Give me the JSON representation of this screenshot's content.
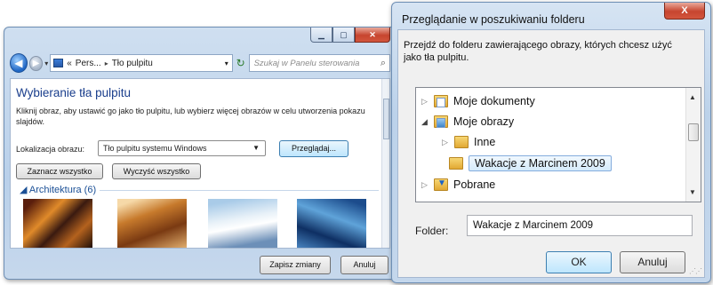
{
  "control_panel": {
    "address": {
      "crumbs": [
        "«",
        "Pers...",
        "Tło pulpitu"
      ],
      "separator": "▸"
    },
    "search_placeholder": "Szukaj w Panelu sterowania",
    "title": "Wybieranie tła pulpitu",
    "description": "Kliknij obraz, aby ustawić go jako tło pulpitu, lub wybierz więcej obrazów w celu utworzenia pokazu slajdów.",
    "location_label": "Lokalizacja obrazu:",
    "location_value": "Tło pulpitu systemu Windows",
    "browse_button": "Przeglądaj...",
    "select_all_button": "Zaznacz wszystko",
    "clear_all_button": "Wyczyść wszystko",
    "group_heading": "Architektura (6)",
    "save_button": "Zapisz zmiany",
    "cancel_button": "Anuluj"
  },
  "dialog": {
    "title": "Przeglądanie w poszukiwaniu folderu",
    "close_glyph": "X",
    "description": "Przejdź do folderu zawierającego obrazy, których chcesz użyć jako tła pulpitu.",
    "tree": [
      {
        "label": "Moje dokumenty",
        "icon": "documents-folder-icon",
        "expanded": false,
        "level": 0,
        "selected": false
      },
      {
        "label": "Moje obrazy",
        "icon": "pictures-folder-icon",
        "expanded": true,
        "level": 0,
        "selected": false
      },
      {
        "label": "Inne",
        "icon": "folder-icon",
        "expanded": false,
        "level": 1,
        "selected": false
      },
      {
        "label": "Wakacje z Marcinem 2009",
        "icon": "folder-icon",
        "expanded": null,
        "level": 1,
        "selected": true
      },
      {
        "label": "Pobrane",
        "icon": "downloads-folder-icon",
        "expanded": false,
        "level": 0,
        "selected": false
      }
    ],
    "folder_label": "Folder:",
    "folder_value": "Wakacje z Marcinem 2009",
    "ok_button": "OK",
    "cancel_button": "Anuluj"
  }
}
